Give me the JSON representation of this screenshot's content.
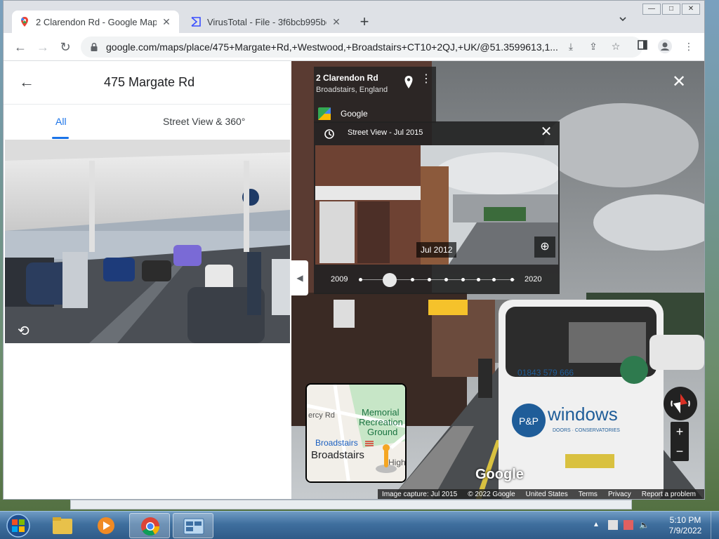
{
  "browser": {
    "tabs": [
      {
        "title": "2 Clarendon Rd - Google Maps",
        "active": true
      },
      {
        "title": "VirusTotal - File - 3f6bcb995be2d",
        "active": false
      }
    ],
    "url": "google.com/maps/place/475+Margate+Rd,+Westwood,+Broadstairs+CT10+2QJ,+UK/@51.3599613,1...",
    "window_controls": [
      "minimize",
      "maximize",
      "close"
    ]
  },
  "left_panel": {
    "title": "475 Margate Rd",
    "tabs": [
      {
        "label": "All",
        "active": true
      },
      {
        "label": "Street View & 360°",
        "active": false
      }
    ]
  },
  "street_view": {
    "address_line1": "2 Clarendon Rd",
    "address_line2": "Broadstairs, England",
    "source": "Google",
    "time_machine": {
      "title": "Street View - Jul 2015",
      "image_date": "Jul 2012",
      "year_start": "2009",
      "year_end": "2020",
      "selected_fraction": 0.2
    },
    "minimap_labels": {
      "memorial": "Memorial",
      "recreation": "Recreation",
      "ground": "Ground",
      "street": "ercy Rd",
      "station": "Broadstairs",
      "town": "Broadstairs",
      "high": "High"
    },
    "watermark": "Google",
    "footer": [
      "Image capture: Jul 2015",
      "© 2022 Google",
      "United States",
      "Terms",
      "Privacy",
      "Report a problem"
    ],
    "bus_phone": "01843 579 666",
    "bus_brand": "windows",
    "bus_tagline": "DOORS · CONSERVATORIES",
    "bus_logo": "P&P"
  },
  "taskbar": {
    "time": "5:10 PM",
    "date": "7/9/2022",
    "apps": [
      "explorer",
      "media-player",
      "chrome",
      "control-panel"
    ]
  }
}
